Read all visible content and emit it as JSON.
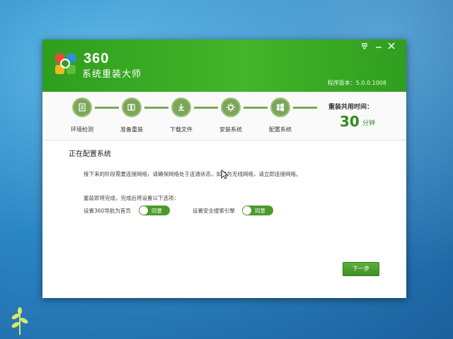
{
  "app": {
    "brand_number": "360",
    "brand_name": "系统重装大师",
    "version": "程序版本：5.0.0.1008"
  },
  "window_controls": {
    "menu_icon": "menu-icon",
    "minimize_icon": "minimize-icon",
    "close_icon": "close-icon"
  },
  "steps": [
    {
      "label": "环境检测",
      "icon": "monitor-icon"
    },
    {
      "label": "准备重装",
      "icon": "files-icon"
    },
    {
      "label": "下载文件",
      "icon": "download-icon"
    },
    {
      "label": "安装系统",
      "icon": "gear-icon"
    },
    {
      "label": "配置系统",
      "icon": "windows-icon"
    }
  ],
  "time": {
    "title": "重装共用时间：",
    "value": "30",
    "unit": "分钟"
  },
  "content": {
    "section_title": "正在配置系统",
    "notice": "接下来的阶段需要连接网络，请确保网络处于连通状态，如果为无线网络，请立即连接网络。",
    "options_title": "重装即将完成，完成后将设置以下选项：",
    "options": [
      {
        "label": "设置360导航为首页",
        "toggle_text": "同意",
        "enabled": true
      },
      {
        "label": "设置安全搜索引擎",
        "toggle_text": "同意",
        "enabled": true
      }
    ],
    "next_button": "下一步"
  },
  "colors": {
    "brand_green": "#44b42a",
    "step_green": "#7da65a",
    "button_green": "#4c9a2a"
  }
}
